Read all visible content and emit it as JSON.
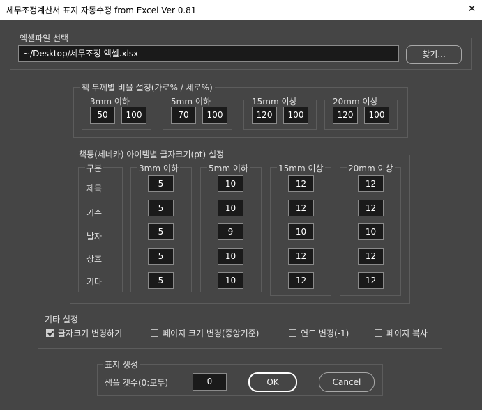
{
  "window": {
    "title": "세무조정계산서 표지 자동수정 from Excel Ver 0.81",
    "close_glyph": "✕"
  },
  "excel": {
    "label": "엑셀파일 선택",
    "path": "~/Desktop/세무조정 엑셀.xlsx",
    "browse": "찾기..."
  },
  "ratio": {
    "label": "책 두께별 비율 설정(가로% / 세로%)",
    "groups": [
      {
        "label": "3mm 이하",
        "w": "50",
        "h": "100"
      },
      {
        "label": "5mm 이하",
        "w": "70",
        "h": "100"
      },
      {
        "label": "15mm 이상",
        "w": "120",
        "h": "100"
      },
      {
        "label": "20mm 이상",
        "w": "120",
        "h": "100"
      }
    ]
  },
  "font": {
    "label": "책등(세네카) 아이템별 글자크기(pt) 설정",
    "header_label": "구분",
    "rows": [
      "제목",
      "기수",
      "날자",
      "상호",
      "기타"
    ],
    "cols": [
      {
        "label": "3mm 이하",
        "values": [
          "5",
          "5",
          "5",
          "5",
          "5"
        ]
      },
      {
        "label": "5mm 이하",
        "values": [
          "10",
          "10",
          "9",
          "10",
          "10"
        ]
      },
      {
        "label": "15mm 이상",
        "values": [
          "12",
          "12",
          "10",
          "12",
          "12"
        ]
      },
      {
        "label": "20mm 이상",
        "values": [
          "12",
          "12",
          "10",
          "12",
          "12"
        ]
      }
    ]
  },
  "etc": {
    "label": "기타 설정",
    "options": [
      {
        "label": "글자크기 변경하기",
        "checked": true
      },
      {
        "label": "페이지 크기 변경(중앙기준)",
        "checked": false
      },
      {
        "label": "연도 변경(-1)",
        "checked": false
      },
      {
        "label": "페이지 복사",
        "checked": false
      }
    ]
  },
  "gen": {
    "label": "표지 생성",
    "sample_label": "샘플 갯수(0:모두)",
    "sample_value": "0",
    "ok": "OK",
    "cancel": "Cancel"
  }
}
